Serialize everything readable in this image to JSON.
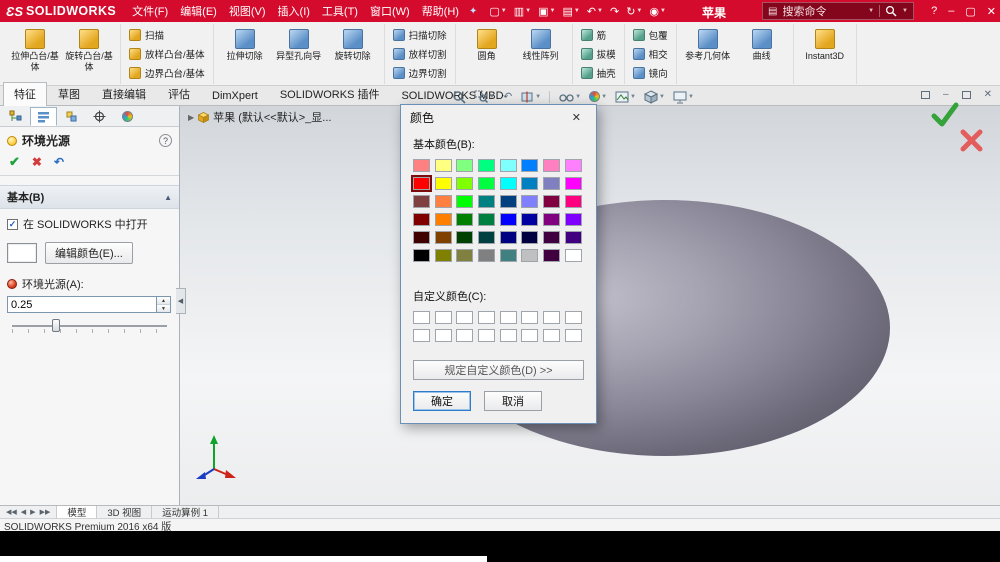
{
  "colors": {
    "titlebar_red": "#d50b2d",
    "selected_basic_color": "#FF0000",
    "sphere_base": "#8a8798",
    "confirm_green": "#35a33a",
    "confirm_red": "#e35d5d"
  },
  "titlebar": {
    "logo_mark": "ƐS",
    "logo_text": "SOLIDWORKS",
    "menus": [
      "文件(F)",
      "编辑(E)",
      "视图(V)",
      "插入(I)",
      "工具(T)",
      "窗口(W)",
      "帮助(H)"
    ],
    "document_title": "苹果",
    "search_placeholder": "搜索命令",
    "help_glyph": "?",
    "minimize_glyph": "–",
    "restore_glyph": "▢",
    "close_glyph": "✕"
  },
  "ribbon": {
    "groups": [
      {
        "kind": "large",
        "items": [
          "拉伸凸台/基体",
          "旋转凸台/基体"
        ]
      },
      {
        "kind": "stack",
        "items": [
          "扫描",
          "放样凸台/基体",
          "边界凸台/基体"
        ]
      },
      {
        "kind": "large",
        "items": [
          "拉伸切除",
          "异型孔向导",
          "旋转切除"
        ]
      },
      {
        "kind": "stack",
        "items": [
          "扫描切除",
          "放样切割",
          "边界切割"
        ]
      },
      {
        "kind": "large",
        "items": [
          "圆角",
          "线性阵列"
        ]
      },
      {
        "kind": "stack",
        "items": [
          "筋",
          "拔模",
          "抽壳"
        ]
      },
      {
        "kind": "stack",
        "items": [
          "包覆",
          "相交",
          "镜向"
        ]
      },
      {
        "kind": "large",
        "items": [
          "参考几何体",
          "曲线"
        ]
      },
      {
        "kind": "large",
        "items": [
          "Instant3D"
        ]
      }
    ]
  },
  "command_tabs": {
    "items": [
      "特征",
      "草图",
      "直接编辑",
      "评估",
      "DimXpert",
      "SOLIDWORKS 插件",
      "SOLIDWORKS MBD"
    ],
    "active": "特征"
  },
  "headsup_icons": [
    "zoom-to-fit",
    "zoom-to-area",
    "previous-view",
    "section-view",
    "view-settings",
    "appearances",
    "apply-scene",
    "view-orientation",
    "display-style"
  ],
  "panel_tabs": [
    "feature-manager",
    "property-manager",
    "configuration-manager",
    "dimxpert-manager",
    "display-manager"
  ],
  "property_panel": {
    "title": "环境光源",
    "help_glyph": "?",
    "section_basic": "基本(B)",
    "open_in_checkbox": "在 SOLIDWORKS 中打开",
    "checkbox_checked": true,
    "edit_color_button": "编辑颜色(E)...",
    "ambient_label": "环境光源(A):",
    "ambient_value": "0.25"
  },
  "viewport": {
    "tree_item": "苹果 (默认<<默认>_显..."
  },
  "color_dialog": {
    "title": "颜色",
    "close_glyph": "✕",
    "basic_label": "基本颜色(B):",
    "custom_label": "自定义颜色(C):",
    "define_button": "规定自定义颜色(D) >>",
    "ok_button": "确定",
    "cancel_button": "取消",
    "basic_colors": [
      "#FF8080",
      "#FFFF80",
      "#80FF80",
      "#00FF80",
      "#80FFFF",
      "#0080FF",
      "#FF80C0",
      "#FF80FF",
      "#FF0000",
      "#FFFF00",
      "#80FF00",
      "#00FF40",
      "#00FFFF",
      "#0080C0",
      "#8080C0",
      "#FF00FF",
      "#804040",
      "#FF8040",
      "#00FF00",
      "#008080",
      "#004080",
      "#8080FF",
      "#800040",
      "#FF0080",
      "#800000",
      "#FF8000",
      "#008000",
      "#008040",
      "#0000FF",
      "#0000A0",
      "#800080",
      "#8000FF",
      "#400000",
      "#804000",
      "#004000",
      "#004040",
      "#000080",
      "#000040",
      "#400040",
      "#400080",
      "#000000",
      "#808000",
      "#808040",
      "#808080",
      "#408080",
      "#C0C0C0",
      "#400040",
      "#FFFFFF"
    ],
    "custom_colors": [
      "#FFFFFF",
      "#FFFFFF",
      "#FFFFFF",
      "#FFFFFF",
      "#FFFFFF",
      "#FFFFFF",
      "#FFFFFF",
      "#FFFFFF",
      "#FFFFFF",
      "#FFFFFF",
      "#FFFFFF",
      "#FFFFFF",
      "#FFFFFF",
      "#FFFFFF",
      "#FFFFFF",
      "#FFFFFF"
    ]
  },
  "bottom_tabs": {
    "items": [
      "模型",
      "3D 视图",
      "运动算例 1"
    ],
    "active": "模型"
  },
  "statusbar": {
    "text": "SOLIDWORKS Premium 2016 x64 版"
  }
}
